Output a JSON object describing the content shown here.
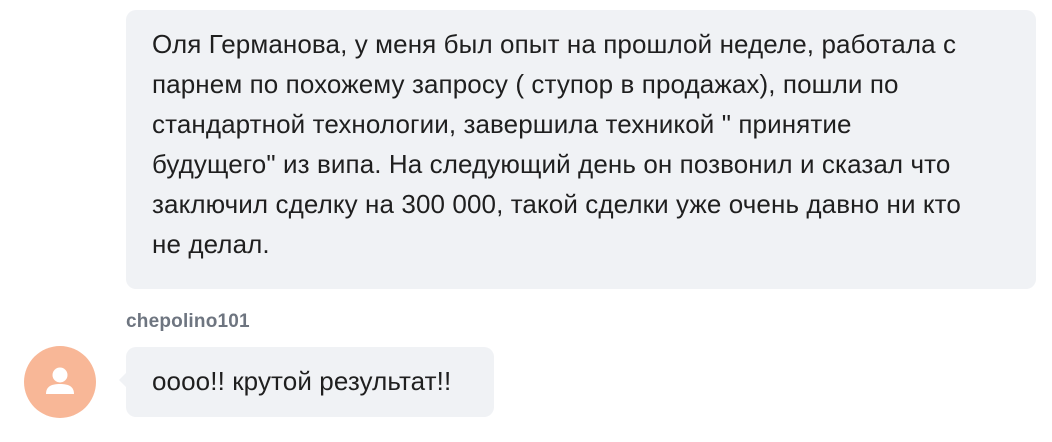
{
  "messages": [
    {
      "lines": [
        "Оля Германова, у меня был опыт на прошлой неделе, работала с",
        "парнем по похожему запросу ( ступор в продажах), пошли по",
        "стандартной технологии, завершила техникой \" принятие",
        "будущего\" из випа.  На следующий день он позвонил и сказал что",
        "заключил сделку на 300 000, такой сделки уже очень давно ни кто",
        "не делал."
      ]
    },
    {
      "author": "chepolino101",
      "avatar_icon": "user-silhouette-icon",
      "avatar_color": "#f8b797",
      "text": "оооо!! крутой результат!!"
    }
  ],
  "colors": {
    "bubble_background": "#f0f2f5",
    "author_text": "#6e7580",
    "message_text": "#1f1f1f"
  }
}
